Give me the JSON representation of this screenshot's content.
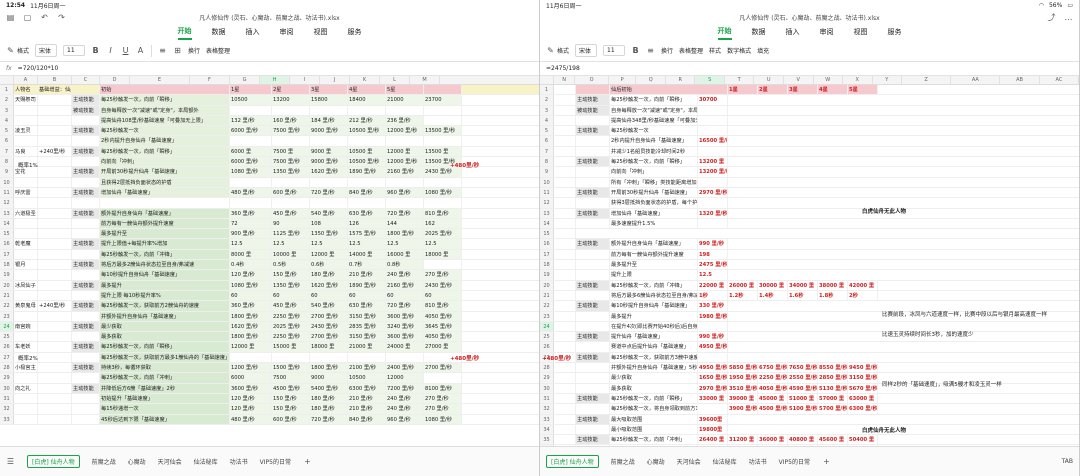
{
  "left": {
    "status": {
      "time": "12:54",
      "date": "11月6日周一"
    },
    "file_title": "凡人修仙传 (灵石、心魔劫、前魔之战、功法书).xlsx",
    "menu_tabs": [
      "开始",
      "数据",
      "插入",
      "审阅",
      "视图",
      "服务"
    ],
    "toolbar": {
      "format": "格式",
      "font": "宋体",
      "size": "11",
      "wrap": "换行",
      "table_tidy": "表格整理",
      "style": "样式",
      "number": "数字格式",
      "merge": "合并"
    },
    "formula": "=720/120*10",
    "columns": [
      "A",
      "B",
      "C",
      "D",
      "E",
      "F",
      "G",
      "H",
      "I",
      "J",
      "K",
      "L",
      "M"
    ],
    "rows": [
      [
        "1",
        "人物名",
        "基础增益：仙舟基础速度",
        "",
        "初始",
        "",
        "",
        "1星",
        "2星",
        "3星",
        "4星",
        "5星"
      ],
      [
        "2",
        "天赐祭司",
        "",
        "主动技能",
        "每25秒触发一次，向前「瞬移」",
        "",
        "",
        "10500",
        "13200",
        "15800",
        "18400",
        "21000",
        "23700"
      ],
      [
        "3",
        "",
        "",
        "被动技能",
        "自身每释放一次\"减速\"或\"定身\"，本局额外",
        "",
        "",
        "",
        "",
        "",
        "",
        "",
        ""
      ],
      [
        "4",
        "",
        "",
        "",
        "提高仙舟108里/秒基础速度「可叠加无上限」",
        "",
        "",
        "132 里/秒",
        "160 里/秒",
        "184 里/秒",
        "212 里/秒",
        "236 里/秒",
        ""
      ],
      [
        "5",
        "凌玉灵",
        "",
        "主动技能",
        "每25秒触发一次",
        "",
        "",
        "6000 里/秒",
        "7500 里/秒",
        "9000 里/秒",
        "10500 里/秒",
        "12000 里/秒",
        "13500 里/秒"
      ],
      [
        "6",
        "",
        "",
        "",
        "2秒内提升自身仙舟「基础速度」",
        "",
        "",
        "",
        "",
        "",
        "",
        "",
        ""
      ],
      [
        "7",
        "马良",
        "+240里/秒",
        "主动技能",
        "每25秒触发一次，向前「瞬移」",
        "",
        "",
        "6000 里",
        "7500 里",
        "9000 里",
        "10500 里",
        "12000 里",
        "13500 里"
      ],
      [
        "8",
        "",
        "",
        "",
        "向前向「冲刺」",
        "",
        "",
        "6000 里/秒",
        "7500 里/秒",
        "9000 里/秒",
        "10500 里/秒",
        "12000 里/秒",
        "13500 里/秒"
      ],
      [
        "9",
        "宝花",
        "",
        "主动技能",
        "开局前30秒提升仙舟「基础速度」",
        "",
        "",
        "1080 里/秒",
        "1350 里/秒",
        "1620 里/秒",
        "1890 里/秒",
        "2160 里/秒",
        "2430 里/秒"
      ],
      [
        "10",
        "",
        "",
        "",
        "且获得2层抵挡负面状态的护盾",
        "",
        "",
        "",
        "",
        "",
        "",
        "",
        ""
      ],
      [
        "11",
        "呼庆雷",
        "",
        "主动技能",
        "增加仙舟「基础速度」",
        "",
        "",
        "480 里/秒",
        "600 里/秒",
        "720 里/秒",
        "840 里/秒",
        "960 里/秒",
        "1080 里/秒"
      ],
      [
        "12",
        "",
        "",
        "",
        "",
        "",
        "",
        "",
        "",
        "",
        "",
        "",
        ""
      ],
      [
        "13",
        "六道极圣",
        "",
        "主动技能",
        "额外提升自身仙舟「基础速度」",
        "",
        "",
        "360 里/秒",
        "450 里/秒",
        "540 里/秒",
        "630 里/秒",
        "720 里/秒",
        "810 里/秒"
      ],
      [
        "14",
        "",
        "",
        "",
        "前方每有一艘仙舟额外提升速度",
        "",
        "",
        "72",
        "90",
        "108",
        "126",
        "144",
        "162"
      ],
      [
        "15",
        "",
        "",
        "",
        "最多提升至",
        "",
        "",
        "900 里/秒",
        "1125 里/秒",
        "1350 里/秒",
        "1575 里/秒",
        "1800 里/秒",
        "2025 里/秒"
      ],
      [
        "16",
        "乾老魔",
        "",
        "主动技能",
        "提升上限值+每提升率%增加",
        "",
        "",
        "12.5",
        "12.5",
        "12.5",
        "12.5",
        "12.5",
        "12.5"
      ],
      [
        "17",
        "",
        "",
        "",
        "每25秒触发一次，向前「冲锋」",
        "",
        "",
        "8000 里",
        "10000 里",
        "12000 里",
        "14000 里",
        "16000 里",
        "18000 里"
      ],
      [
        "18",
        "银月",
        "",
        "主动技能",
        "将后方最多2艘仙舟状态拉至自身/弗减速",
        "",
        "",
        "0.4秒",
        "0.5秒",
        "0.6秒",
        "0.7秒",
        "0.8秒",
        ""
      ],
      [
        "19",
        "",
        "",
        "",
        "每10秒提升自身仙舟「基础速度」",
        "",
        "",
        "120 里/秒",
        "150 里/秒",
        "180 里/秒",
        "210 里/秒",
        "240 里/秒",
        "270 里/秒"
      ],
      [
        "20",
        "冰凤仙子",
        "",
        "主动技能",
        "最多提升",
        "",
        "",
        "1080 里/秒",
        "1350 里/秒",
        "1620 里/秒",
        "1890 里/秒",
        "2160 里/秒",
        "2430 里/秒"
      ],
      [
        "21",
        "",
        "",
        "",
        "提升上限 每10秒提升率%",
        "",
        "",
        "60",
        "60",
        "60",
        "60",
        "60",
        "60"
      ],
      [
        "22",
        "黄泉鬼母",
        "+240里/秒",
        "主动技能",
        "每25秒触发一次，获取前方2艘仙舟的速度",
        "",
        "",
        "360 里/秒",
        "450 里/秒",
        "540 里/秒",
        "630 里/秒",
        "720 里/秒",
        "810 里/秒"
      ],
      [
        "23",
        "",
        "",
        "",
        "并额外提升自身仙舟「基础速度」",
        "",
        "",
        "1800 里/秒",
        "2250 里/秒",
        "2700 里/秒",
        "3150 里/秒",
        "3600 里/秒",
        "4050 里/秒"
      ],
      [
        "24",
        "南宫婉",
        "",
        "主动技能",
        "最少获取",
        "",
        "",
        "1620 里/秒",
        "2025 里/秒",
        "2430 里/秒",
        "2835 里/秒",
        "3240 里/秒",
        "3645 里/秒"
      ],
      [
        "25",
        "",
        "",
        "",
        "最多获取",
        "",
        "",
        "1800 里/秒",
        "2250 里/秒",
        "2700 里/秒",
        "3150 里/秒",
        "3600 里/秒",
        "4050 里/秒"
      ],
      [
        "26",
        "车老妖",
        "",
        "主动技能",
        "每25秒触发一次，向前「瞬移」",
        "",
        "",
        "12000 里",
        "15000 里",
        "18000 里",
        "21000 里",
        "24000 里",
        "27000 里"
      ],
      [
        "27",
        "",
        "",
        "",
        "每25秒触发一次，获取前方最多1艘仙舟的「基础速度」",
        "",
        "",
        "",
        "",
        "",
        "",
        "",
        ""
      ],
      [
        "28",
        "小极宫主",
        "",
        "主动技能",
        "持续3秒，每循环获取",
        "",
        "",
        "1200 里/秒",
        "1500 里/秒",
        "1800 里/秒",
        "2100 里/秒",
        "2400 里/秒",
        "2700 里/秒"
      ],
      [
        "29",
        "",
        "",
        "",
        "每25秒触发一次，向前「冲刺」",
        "",
        "",
        "6000",
        "7500",
        "9000",
        "10500",
        "12000",
        ""
      ],
      [
        "30",
        "向之礼",
        "",
        "主动技能",
        "并降低后方6艘「基础速度」2秒",
        "",
        "",
        "3600 里/秒",
        "4500 里/秒",
        "5400 里/秒",
        "6300 里/秒",
        "7200 里/秒",
        "8100 里/秒"
      ],
      [
        "31",
        "",
        "",
        "",
        "初始提升「基础速度」",
        "",
        "",
        "120 里/秒",
        "150 里/秒",
        "180 里/秒",
        "210 里/秒",
        "240 里/秒",
        "270 里/秒"
      ],
      [
        "32",
        "",
        "",
        "",
        "每15秒递增一次",
        "",
        "",
        "120 里/秒",
        "150 里/秒",
        "180 里/秒",
        "210 里/秒",
        "240 里/秒",
        "270 里/秒"
      ],
      [
        "33",
        "",
        "",
        "",
        "45秒后达到下限「基础速度」",
        "",
        "",
        "480 里/秒",
        "600 里/秒",
        "720 里/秒",
        "840 里/秒",
        "960 里/秒",
        "1080 里/秒"
      ]
    ],
    "prob1": "概率1%",
    "prob2": "概率2%",
    "red_left_1": "+480里/秒",
    "red_left_2": "+480里/秒",
    "sheet_tabs": [
      "[白虎] 仙舟人物",
      "前魔之战",
      "心魔劫",
      "天河仙会",
      "仙法秘库",
      "功法书",
      "VIP5的日常"
    ]
  },
  "right": {
    "status": {
      "date": "11月6日周一",
      "battery": "56%"
    },
    "file_title": "凡人修仙传 (灵石、心魔劫、前魔之战、功法书).xlsx",
    "menu_tabs": [
      "开始",
      "数据",
      "插入",
      "审阅",
      "视图",
      "服务"
    ],
    "toolbar": {
      "format": "格式",
      "font": "宋体",
      "size": "11",
      "wrap": "换行",
      "table_tidy": "表格整理",
      "style": "样式",
      "number": "数字格式",
      "fill": "填充",
      "merge": "合并"
    },
    "formula": "=2475/198",
    "columns": [
      "N",
      "O",
      "P",
      "Q",
      "R",
      "S",
      "T",
      "U",
      "V",
      "W",
      "X",
      "Y",
      "Z",
      "AA",
      "AB",
      "AC"
    ],
    "header": {
      "title": "仙后初始",
      "stars": [
        "1星",
        "2星",
        "3星",
        "4星",
        "5星"
      ]
    },
    "lines": [
      {
        "skill": "主动技能",
        "desc": "每25秒触发一次，向前「瞬移」",
        "val": "30700"
      },
      {
        "skill": "被动技能",
        "desc": "自身每释放一次\"减速\"或\"定身\"，本局额外",
        "val": ""
      },
      {
        "skill": "",
        "desc": "提高仙舟348里/秒基础速度「可叠加无上限」",
        "val": ""
      },
      {
        "skill": "主动技能",
        "desc": "每25秒触发一次",
        "val": ""
      },
      {
        "skill": "",
        "desc": "2秒内提升自身仙舟「基础速度」",
        "val": "16500 里/秒"
      },
      {
        "skill": "",
        "desc": "并减少1名船员技能冷却时间2秒",
        "val": ""
      },
      {
        "skill": "主动技能",
        "desc": "每25秒触发一次，向前「瞬移」",
        "val": "13200 里"
      },
      {
        "skill": "",
        "desc": "向前向「冲刺」",
        "val": "13200 里/秒"
      },
      {
        "skill": "",
        "desc": "所有「冲刺」「瞬移」类技能距离增加1.5%",
        "val": ""
      },
      {
        "skill": "主动技能",
        "desc": "开局前30秒提升仙舟「基础速度」",
        "val": "2970 里/秒"
      },
      {
        "skill": "",
        "desc": "获得3层抵挡负面状态的护盾，每个护盾被击破后在该场比赛中永久提升自身仙舟0.5%总速度",
        "val": ""
      },
      {
        "skill": "主动技能",
        "desc": "增加仙舟「基础速度」",
        "val": "1320 里/秒"
      },
      {
        "skill": "",
        "desc": "最多速度提升1.5%",
        "val": ""
      }
    ],
    "lines2": [
      {
        "skill": "主动技能",
        "desc": "额外提升自身仙舟「基础速度」",
        "val": "990 里/秒"
      },
      {
        "skill": "",
        "desc": "前方每有一艘仙舟额外提升速度",
        "val": "198"
      },
      {
        "skill": "",
        "desc": "最多提升至",
        "val": "2475 里/秒"
      },
      {
        "skill": "",
        "desc": "提升上限",
        "val": "12.5"
      },
      {
        "skill": "主动技能",
        "desc": "每25秒触发一次，向前「冲锋」",
        "val": "22000 里"
      },
      {
        "skill": "",
        "desc": "将后方最多6艘仙舟状态拉至自身/弗减速",
        "val": "1秒"
      },
      {
        "skill": "主动技能",
        "desc": "每10秒提升自身仙舟「基础速度」",
        "val": "330 里/秒"
      },
      {
        "skill": "",
        "desc": "最多提升",
        "val": "1980 里/秒"
      },
      {
        "skill": "",
        "desc": "在提升4次(即比赛开始40秒后)后自身将免疫减速效果",
        "val": ""
      },
      {
        "skill": "主动技能",
        "desc": "提升仙舟「基础速度」",
        "val": "990 里/秒"
      },
      {
        "skill": "",
        "desc": "赛道中点后提升仙舟「基础速度」",
        "val": "4950 里/秒"
      },
      {
        "skill": "主动技能",
        "desc": "每25秒触发一次，获取前方3艘中速度快的仙舟的速度",
        "val": ""
      },
      {
        "skill": "",
        "desc": "并额外提升自身仙舟「基础速度」5秒",
        "val": "4950 里/秒"
      },
      {
        "skill": "",
        "desc": "最少获取",
        "val": "1650 里/秒"
      },
      {
        "skill": "",
        "desc": "最多获取",
        "val": "2970 里/秒"
      },
      {
        "skill": "主动技能",
        "desc": "每25秒触发一次，向前「瞬移」",
        "val": "33000 里"
      },
      {
        "skill": "",
        "desc": "每25秒触发一次，将自身领取到前方1艘仙舟速度，并降低该仙舟3300里/秒「基础速度」4秒",
        "val": ""
      },
      {
        "skill": "主动技能",
        "desc": "最大吸取范围",
        "val": "39600里"
      },
      {
        "skill": "",
        "desc": "最小吸取范围",
        "val": "19800里"
      },
      {
        "skill": "主动技能",
        "desc": "每25秒触发一次，向前「冲刺」",
        "val": "26400 里"
      },
      {
        "skill": "",
        "desc": "并降低后方6艘「基础速度」2秒",
        "val": "6600 里/秒"
      },
      {
        "skill": "主动技能",
        "desc": "初始提升「基础速度」",
        "val": "330 里/秒"
      },
      {
        "skill": "",
        "desc": "每15秒递增一次",
        "val": "330 里/秒"
      },
      {
        "skill": "",
        "desc": "45秒后达到下限「基础速度」",
        "val": "990 里/秒"
      },
      {
        "skill": "",
        "desc": "并15秒免疫减速",
        "val": ""
      }
    ],
    "star_rows": [
      {
        "label": "1.2秒",
        "vals": [
          "26000 里",
          "30000 里",
          "34000 里",
          "38000 里",
          "42000 里"
        ],
        "secs": [
          "1.2秒",
          "1.4秒",
          "1.6秒",
          "1.8秒",
          "2秒"
        ]
      }
    ],
    "gp_rows": [
      [
        "5850 里/秒",
        "6750 里/秒",
        "7650 里/秒",
        "8550 里/秒",
        "9450 里/秒"
      ],
      [
        "1950 里/秒",
        "2250 里/秒",
        "2550 里/秒",
        "2850 里/秒",
        "3150 里/秒"
      ],
      [
        "3510 里/秒",
        "4050 里/秒",
        "4590 里/秒",
        "5130 里/秒",
        "5670 里/秒"
      ],
      [
        "39000 里",
        "45000 里",
        "51000 里",
        "57000 里",
        "63000 里"
      ],
      [
        "3900 里/秒",
        "4500 里/秒",
        "5100 里/秒",
        "5700 里/秒",
        "6300 里/秒"
      ]
    ],
    "xi_rows": [
      [
        "31200 里",
        "36000 里",
        "40800 里",
        "45600 里",
        "50400 里"
      ],
      [
        "7800 里/秒",
        "9000 里/秒",
        "10200 里/秒",
        "11400 里/秒",
        "12600 里/秒"
      ]
    ],
    "notes": {
      "n1": "白虎仙舟无此人物",
      "n2": "比赛前段，冰凤与六道速度一样，比赛中段以后与银月最高速度一样",
      "n3": "比速玉灵持续时间长3秒，加的速度少",
      "n4": "同样2秒的「基础速度」，吸满5艘才和凌玉灵一样",
      "n5": "白虎仙舟无此人物"
    },
    "red_mid": "+480里/秒",
    "sheet_tabs": [
      "[白虎] 仙舟人物",
      "前魔之战",
      "心魔劫",
      "天河仙会",
      "仙法秘库",
      "功法书",
      "VIP5的日常"
    ],
    "tab_key": "TAB"
  }
}
